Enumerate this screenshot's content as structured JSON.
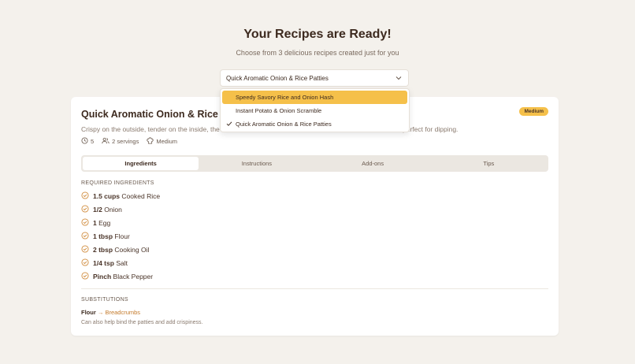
{
  "header": {
    "title": "Your Recipes are Ready!",
    "subtitle": "Choose from 3 delicious recipes created just for you"
  },
  "selector": {
    "selected": "Quick Aromatic Onion & Rice Patties",
    "options": [
      {
        "label": "Speedy Savory Rice and Onion Hash",
        "highlighted": true,
        "checked": false
      },
      {
        "label": "Instant Potato & Onion Scramble",
        "highlighted": false,
        "checked": false
      },
      {
        "label": "Quick Aromatic Onion & Rice Patties",
        "highlighted": false,
        "checked": true
      }
    ]
  },
  "recipe": {
    "title": "Quick Aromatic Onion & Rice Pa",
    "difficulty_badge": "Medium",
    "description": "Crispy on the outside, tender on the inside, the",
    "description_end": "perfect for dipping.",
    "meta": {
      "time": "5",
      "servings": "2 servings",
      "difficulty": "Medium"
    }
  },
  "tabs": [
    {
      "label": "Ingredients",
      "active": true
    },
    {
      "label": "Instructions",
      "active": false
    },
    {
      "label": "Add-ons",
      "active": false
    },
    {
      "label": "Tips",
      "active": false
    }
  ],
  "ingredients": {
    "section_label": "REQUIRED INGREDIENTS",
    "items": [
      {
        "qty": "1.5 cups",
        "name": "Cooked Rice"
      },
      {
        "qty": "1/2",
        "name": "Onion"
      },
      {
        "qty": "1",
        "name": "Egg"
      },
      {
        "qty": "1 tbsp",
        "name": "Flour"
      },
      {
        "qty": "2 tbsp",
        "name": "Cooking Oil"
      },
      {
        "qty": "1/4 tsp",
        "name": "Salt"
      },
      {
        "qty": "Pinch",
        "name": "Black Pepper"
      }
    ]
  },
  "substitutions": {
    "section_label": "SUBSTITUTIONS",
    "from": "Flour",
    "arrow": "→",
    "to": "Breadcrumbs",
    "note": "Can also help bind the patties and add crispiness."
  },
  "colors": {
    "accent": "#f5c04a",
    "link": "#c47a2a",
    "background": "#f4f1ec"
  }
}
